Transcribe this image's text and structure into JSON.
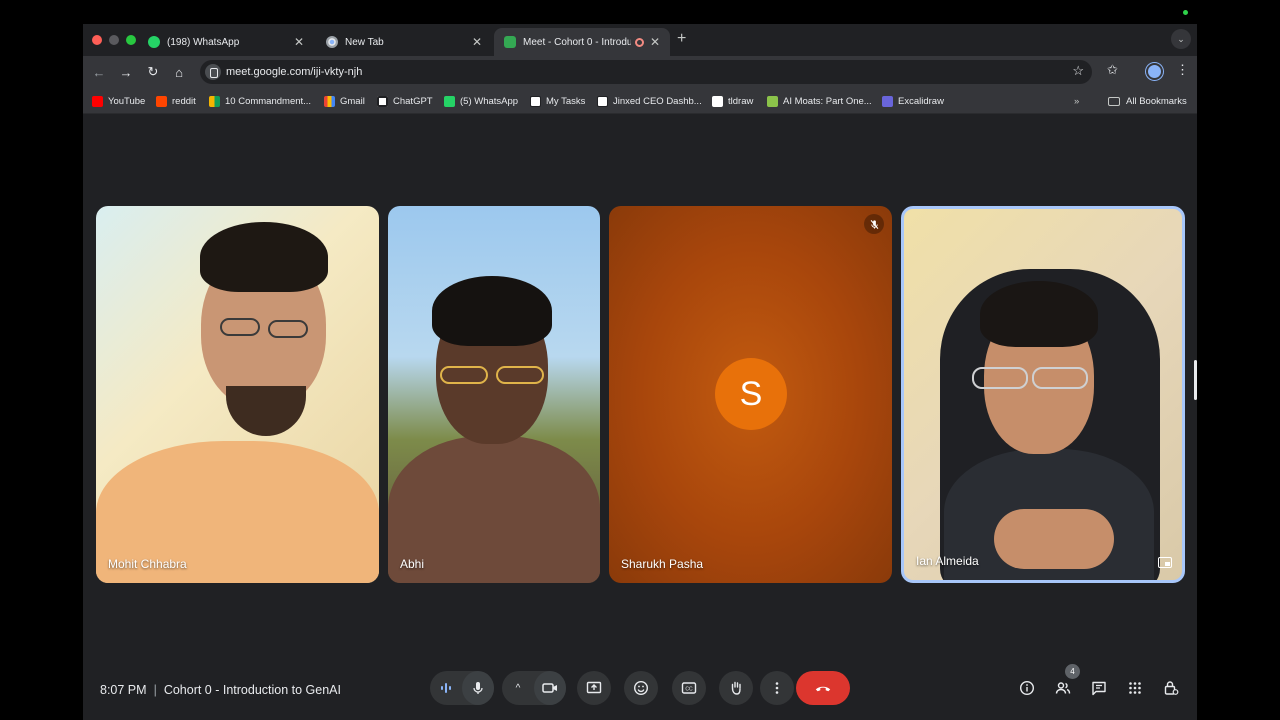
{
  "browser": {
    "tabs": [
      {
        "title": "(198) WhatsApp",
        "favicon": "whatsapp-icon"
      },
      {
        "title": "New Tab",
        "favicon": "chrome-icon"
      },
      {
        "title": "Meet - Cohort 0 - Introdu",
        "favicon": "google-meet-icon",
        "active": true
      }
    ],
    "url": "meet.google.com/iji-vkty-njh",
    "bookmarks": [
      {
        "label": "YouTube",
        "icon": "youtube-icon"
      },
      {
        "label": "reddit",
        "icon": "reddit-icon"
      },
      {
        "label": "10 Commandment...",
        "icon": "sheet-icon"
      },
      {
        "label": "Gmail",
        "icon": "gmail-icon"
      },
      {
        "label": "ChatGPT",
        "icon": "chatgpt-icon"
      },
      {
        "label": "(5) WhatsApp",
        "icon": "whatsapp-icon"
      },
      {
        "label": "My Tasks",
        "icon": "notion-icon"
      },
      {
        "label": "Jinxed CEO Dashb...",
        "icon": "notion-icon"
      },
      {
        "label": "tldraw",
        "icon": "tldraw-icon"
      },
      {
        "label": "AI Moats: Part One...",
        "icon": "doc-icon"
      },
      {
        "label": "Excalidraw",
        "icon": "excalidraw-icon"
      }
    ],
    "all_bookmarks_label": "All Bookmarks"
  },
  "meet": {
    "participants": [
      {
        "name": "Mohit Chhabra"
      },
      {
        "name": "Abhi"
      },
      {
        "name": "Sharukh Pasha",
        "avatar_letter": "S",
        "avatar_color": "#e8710a",
        "muted": true
      },
      {
        "name": "Ian Almeida",
        "speaking": true
      }
    ],
    "time": "8:07 PM",
    "meeting_title": "Cohort 0 - Introduction to GenAI",
    "participant_count": "4",
    "leave_color": "#dc362e"
  }
}
